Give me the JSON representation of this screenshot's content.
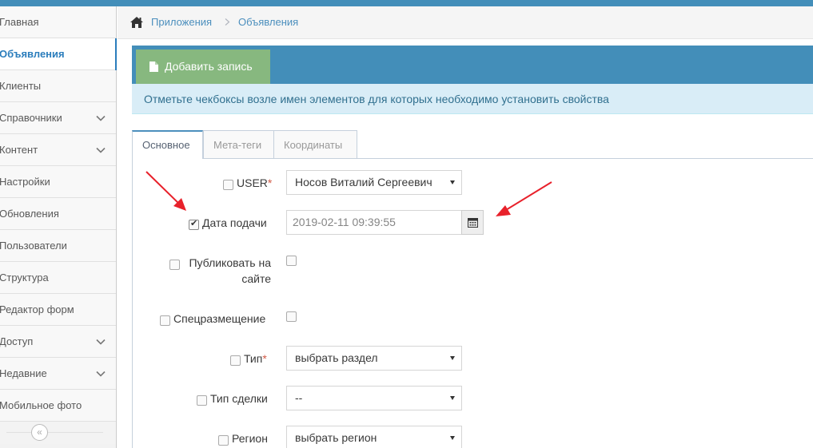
{
  "sidebar": {
    "items": [
      {
        "label": "Главная",
        "has_submenu": false
      },
      {
        "label": "Объявления",
        "has_submenu": false,
        "active": true
      },
      {
        "label": "Клиенты",
        "has_submenu": false
      },
      {
        "label": "Справочники",
        "has_submenu": true
      },
      {
        "label": "Контент",
        "has_submenu": true
      },
      {
        "label": "Настройки",
        "has_submenu": false
      },
      {
        "label": "Обновления",
        "has_submenu": false
      },
      {
        "label": "Пользователи",
        "has_submenu": false
      },
      {
        "label": "Структура",
        "has_submenu": false
      },
      {
        "label": "Редактор форм",
        "has_submenu": false
      },
      {
        "label": "Доступ",
        "has_submenu": true
      },
      {
        "label": "Недавние",
        "has_submenu": true
      },
      {
        "label": "Мобильное фото",
        "has_submenu": false
      }
    ],
    "collapse_glyph": "«"
  },
  "breadcrumb": {
    "items": [
      "Приложения",
      "Объявления"
    ],
    "separator": ">"
  },
  "toolbar": {
    "add_label": "Добавить запись"
  },
  "info": {
    "text": "Отметьте чекбоксы возле имен элементов для которых необходимо установить свойства"
  },
  "tabs": [
    {
      "label": "Основное",
      "active": true
    },
    {
      "label": "Мета-теги",
      "active": false
    },
    {
      "label": "Координаты",
      "active": false
    }
  ],
  "form": {
    "user": {
      "label": "USER",
      "required": "*",
      "value": "Носов Виталий Сергеевич",
      "checked": false
    },
    "date": {
      "label": "Дата подачи",
      "value": "2019-02-11 09:39:55",
      "checked": true
    },
    "publish": {
      "label_line1": "Публиковать на",
      "label_line2": "сайте",
      "checked": false,
      "value_checked": false
    },
    "special": {
      "label": "Спецразмещение",
      "checked": false,
      "value_checked": false
    },
    "type": {
      "label": "Тип",
      "required": "*",
      "value": "выбрать раздел",
      "checked": false
    },
    "deal": {
      "label": "Тип сделки",
      "value": "--",
      "checked": false
    },
    "region": {
      "label": "Регион",
      "value": "выбрать регион",
      "checked": false
    }
  },
  "colors": {
    "header_blue": "#438eb9",
    "add_button_green": "#87b87f",
    "info_bg": "#d9edf7",
    "required_red": "#d15b47",
    "annotation_arrow": "#e8212b"
  }
}
